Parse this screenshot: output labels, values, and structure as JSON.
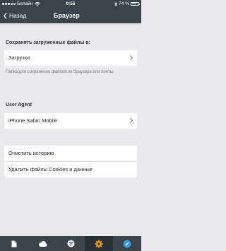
{
  "status": {
    "carrier": "Билайн",
    "time": "9:55",
    "battery": "74 %",
    "battery_level": 0.74
  },
  "nav": {
    "back_label": "Назад",
    "title": "Браузер"
  },
  "downloads": {
    "header": "Сохранять загруженные файлы в:",
    "value": "Загрузки",
    "note": "Папка для сохранения файлов из браузера или почты."
  },
  "useragent": {
    "header": "User Agent",
    "value": "iPhone Safari Mobile"
  },
  "actions": {
    "clear_history": "Очистить историю",
    "delete_cookies": "Удалить файлы Cookies и данные"
  },
  "tabbar": {
    "tabs": [
      {
        "icon": "document-icon"
      },
      {
        "icon": "cloud-icon"
      },
      {
        "icon": "wifi-icon"
      },
      {
        "icon": "gear-icon",
        "active": true,
        "color": "#f39c12"
      },
      {
        "icon": "compass-icon",
        "color": "#3a9ad9"
      }
    ]
  },
  "colors": {
    "bar": "#3d4449",
    "accent_orange": "#f39c12",
    "accent_blue": "#3a9ad9",
    "background": "#e9e9ed"
  }
}
